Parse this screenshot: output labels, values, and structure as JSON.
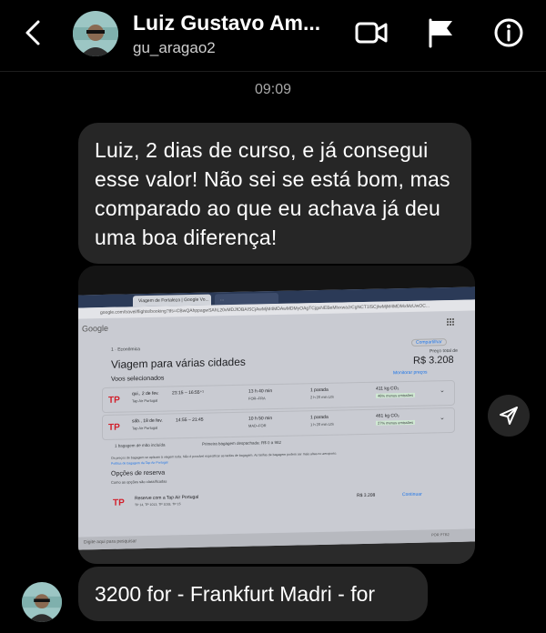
{
  "header": {
    "name": "Luiz Gustavo Am...",
    "username": "gu_aragao2",
    "icons": [
      "back-chevron-icon",
      "video-call-icon",
      "flag-icon",
      "info-icon"
    ]
  },
  "thread": {
    "timestamp": "09:09",
    "message1": "Luiz, 2 dias de curso, e já consegui esse valor! Não sei se está bom, mas comparado ao que eu achava já deu uma boa diferença!",
    "message2": "3200 for - Frankfurt Madri - for"
  },
  "photo": {
    "tab1": "Viagem de Fortaleza | Google Vo...",
    "tab2": "...",
    "url": "google.com/travel/flights/booking?tfs=CBwQAhppagwSAhL20vMDJfOBAISCjAwMjM4MDAwMDMyOAgTCjgxNEBeMlvxwaJrCgNCT1lSCjIwMjM4MDMxMzUwOC...",
    "logo": "Google",
    "trip_meta": "1 · Econômica",
    "compartilhar": "Compartilhar",
    "title": "Viagem para várias cidades",
    "preco_total_label": "Preço total de",
    "price": "R$ 3.208",
    "voos_label": "Voos selecionados",
    "monitorar": "Monitorar preços",
    "flights": [
      {
        "date": "qui., 2 de fev.",
        "times": "23:15 – 16:55⁺¹",
        "airline": "Tap Air Portugal",
        "duration": "13 h 40 min",
        "route": "FOR–FRA",
        "stops": "1 parada",
        "stop_detail": "2 h 20 min LIS",
        "co2": "411 kg CO₂",
        "emissions": "46% menos emissões"
      },
      {
        "date": "sáb., 18 de fev.",
        "times": "14:55 – 21:45",
        "airline": "Tap Air Portugal",
        "duration": "10 h 50 min",
        "route": "MAD–FOR",
        "stops": "1 parada",
        "stop_detail": "1 h 20 min LIS",
        "co2": "461 kg CO₂",
        "emissions": "27% menos emissões"
      }
    ],
    "bag1": "1 bagagem de mão incluída",
    "bag2": "Primeira bagagem despachada: R$ 0 a 982",
    "fine_print1": "Os preços de bagagem se aplicam à viagem toda. Não é possível especificar as tarifas de bagagem. As tarifas de bagagem podem ser mais altas no aeroporto.",
    "fine_print_link": "Política de bagagem da Tap Air Portugal",
    "options_title": "Opções de reserva",
    "options_sub": "Como as opções são classificadas",
    "reserve_text": "Reserve com a Tap Air Portugal",
    "reserve_sub": "TP 14, TP 1013, TP 1018, TP 15",
    "reserve_price": "R$ 3.208",
    "continue": "Continuar",
    "search_placeholder": "Digite aqui para pesquisar",
    "taskbar_lang": "POR PTB2"
  },
  "colors": {
    "background": "#000000",
    "bubble": "#262626",
    "secondary_text": "#a8a8a8",
    "flights_link": "#1a73e8",
    "tap_red": "#d21f2b",
    "tap_green": "#2c8a3c"
  }
}
